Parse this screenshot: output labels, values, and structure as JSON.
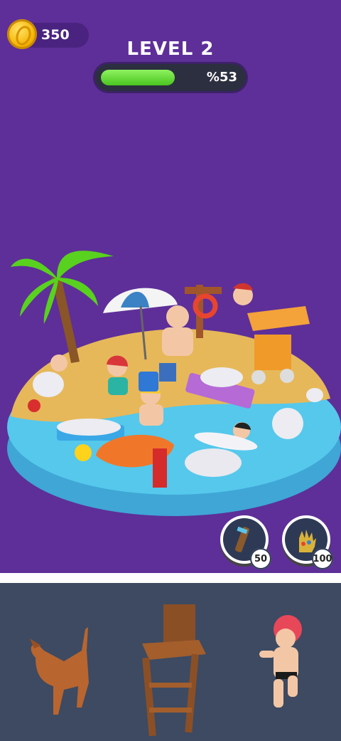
{
  "hud": {
    "coins": "350",
    "coin_icon": "gold-coin-icon",
    "level_label": "LEVEL 2",
    "progress_text": "%53",
    "progress_value": 0.53,
    "progress_color": "#5fd833"
  },
  "powerups": [
    {
      "name": "telescope-powerup",
      "icon": "telescope-icon",
      "cost": "50"
    },
    {
      "name": "magic-glove-powerup",
      "icon": "glove-icon",
      "cost": "100"
    }
  ],
  "tray": {
    "items": [
      {
        "name": "dog-piece",
        "icon": "dog-icon"
      },
      {
        "name": "lifeguard-chair-piece",
        "icon": "lifeguard-chair-icon"
      },
      {
        "name": "swimmer-girl-piece",
        "icon": "girl-figure-icon"
      }
    ]
  },
  "colors": {
    "background": "#5e2f98",
    "tray": "#3d4a61",
    "sand": "#e6b85a",
    "water": "#4fc3e8"
  }
}
